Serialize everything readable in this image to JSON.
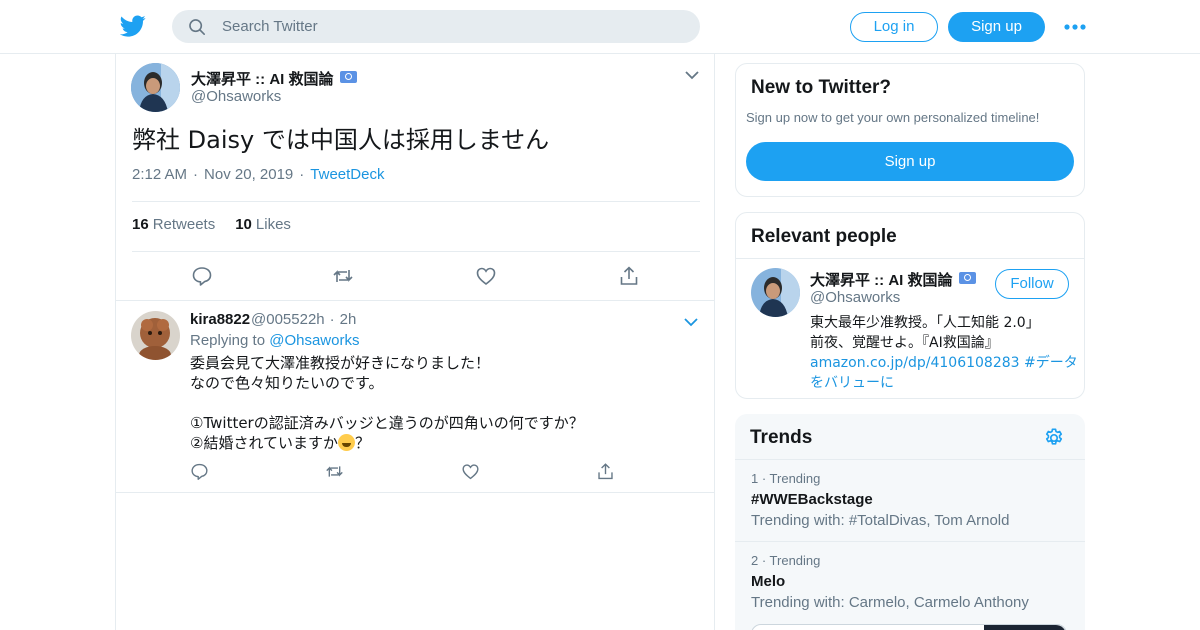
{
  "header": {
    "search_placeholder": "Search Twitter",
    "login_label": "Log in",
    "signup_label": "Sign up",
    "more_icon": "more-dots-icon"
  },
  "main_tweet": {
    "author_name": "大澤昇平 :: AI 救国論",
    "author_handle": "@Ohsaworks",
    "text": "弊社 Daisy では中国人は採用しません",
    "time": "2:12 AM",
    "date": "Nov 20, 2019",
    "source": "TweetDeck",
    "retweets_count": "16",
    "retweets_label": "Retweets",
    "likes_count": "10",
    "likes_label": "Likes"
  },
  "reply_tweet": {
    "author_name": "kira8822",
    "author_handle": "@005522h",
    "age": "2h",
    "replying_prefix": "Replying to",
    "replying_to": "@Ohsaworks",
    "lines": [
      "委員会見て大澤准教授が好きになりました！",
      "なので色々知りたいのです。",
      "",
      "①Twitterの認証済みバッジと違うのが四角いの何ですか？",
      "②結婚されていますか"
    ],
    "last_line_suffix": "？"
  },
  "sidebar": {
    "new_to_twitter": {
      "title": "New to Twitter?",
      "subtitle": "Sign up now to get your own personalized timeline!",
      "signup_label": "Sign up"
    },
    "relevant_people": {
      "title": "Relevant people",
      "name": "大澤昇平 :: AI 救国論",
      "handle": "@Ohsaworks",
      "follow_label": "Follow",
      "bio_line1": "東大最年少准教授。「人工知能 2.0」",
      "bio_line2": "前夜、覚醒せよ。『AI救国論』",
      "bio_link": "amazon.co.jp/dp/4106108283",
      "bio_hashtag_a": "#データ",
      "bio_hashtag_b": "をバリューに"
    },
    "trends": {
      "title": "Trends",
      "items": [
        {
          "rank": "1 · Trending",
          "name": "#WWEBackstage",
          "with": "Trending with: #TotalDivas, Tom Arnold"
        },
        {
          "rank": "2 · Trending",
          "name": "Melo",
          "with": "Trending with: Carmelo, Carmelo Anthony"
        }
      ]
    }
  },
  "colors": {
    "accent": "#1da1f2",
    "link": "#1b95e0",
    "secondary_text": "#657786",
    "border": "#e6ecf0"
  }
}
